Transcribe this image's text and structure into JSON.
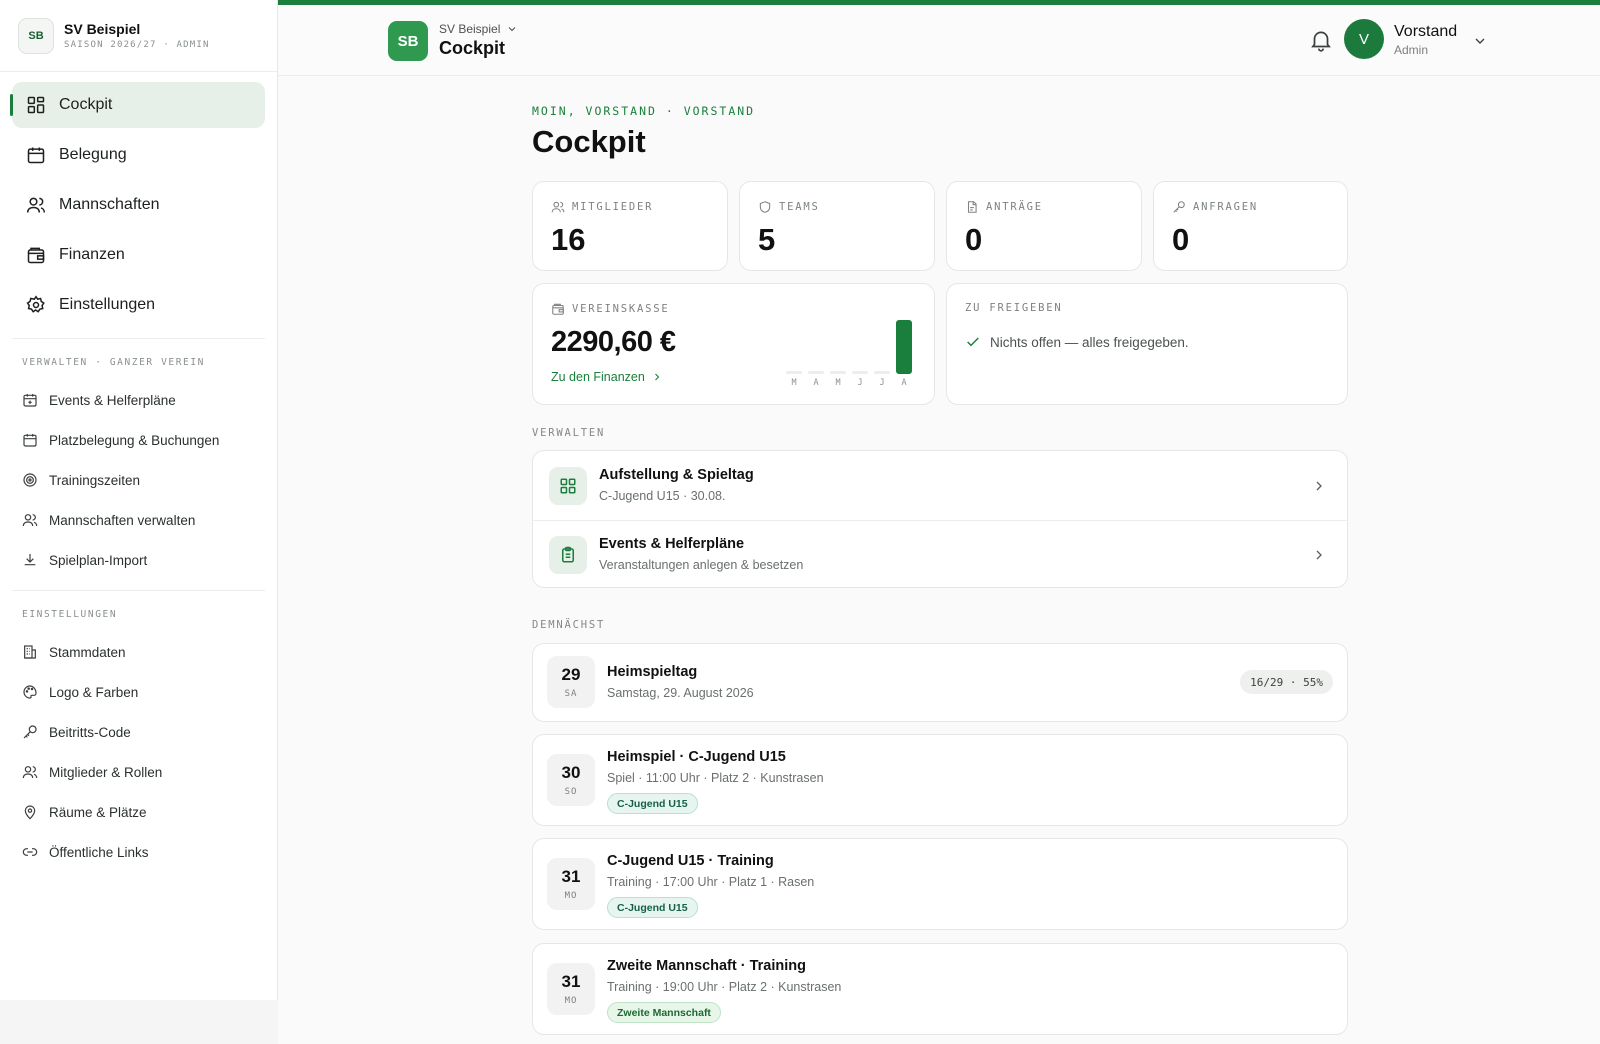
{
  "sidebar": {
    "brand": {
      "initials": "SB",
      "name": "SV Beispiel",
      "sub": "SAISON 2026/27 · ADMIN"
    },
    "main_nav": [
      {
        "label": "Cockpit",
        "icon": "grid-icon",
        "active": true
      },
      {
        "label": "Belegung",
        "icon": "calendar-icon"
      },
      {
        "label": "Mannschaften",
        "icon": "users-icon"
      },
      {
        "label": "Finanzen",
        "icon": "wallet-icon"
      },
      {
        "label": "Einstellungen",
        "icon": "gear-icon"
      }
    ],
    "section_manage": "VERWALTEN · GANZER VEREIN",
    "manage_items": [
      {
        "label": "Events & Helferpläne",
        "icon": "calendar-plus-icon"
      },
      {
        "label": "Platzbelegung & Buchungen",
        "icon": "calendar-icon"
      },
      {
        "label": "Trainingszeiten",
        "icon": "target-icon"
      },
      {
        "label": "Mannschaften verwalten",
        "icon": "users-icon"
      },
      {
        "label": "Spielplan-Import",
        "icon": "download-icon"
      }
    ],
    "section_settings": "EINSTELLUNGEN",
    "settings_items": [
      {
        "label": "Stammdaten",
        "icon": "building-icon"
      },
      {
        "label": "Logo & Farben",
        "icon": "palette-icon"
      },
      {
        "label": "Beitritts-Code",
        "icon": "key-icon"
      },
      {
        "label": "Mitglieder & Rollen",
        "icon": "users-icon"
      },
      {
        "label": "Räume & Plätze",
        "icon": "map-pin-icon"
      },
      {
        "label": "Öffentliche Links",
        "icon": "link-icon"
      }
    ]
  },
  "header": {
    "logo": "SB",
    "club": "SV Beispiel",
    "title": "Cockpit",
    "user": {
      "initial": "V",
      "name": "Vorstand",
      "role": "Admin"
    }
  },
  "page": {
    "greeting": "MOIN, VORSTAND · VORSTAND",
    "title": "Cockpit"
  },
  "stats": [
    {
      "label": "MITGLIEDER",
      "value": "16",
      "icon": "users-icon"
    },
    {
      "label": "TEAMS",
      "value": "5",
      "icon": "shield-icon"
    },
    {
      "label": "ANTRÄGE",
      "value": "0",
      "icon": "document-icon"
    },
    {
      "label": "ANFRAGEN",
      "value": "0",
      "icon": "key-icon"
    }
  ],
  "kasse": {
    "label": "VEREINSKASSE",
    "value": "2290,60 €",
    "link": "Zu den Finanzen",
    "months": [
      "M",
      "A",
      "M",
      "J",
      "J",
      "A"
    ],
    "levels": [
      0.04,
      0.04,
      0.04,
      0.04,
      0.04,
      1.0
    ],
    "accent": "#1a7f3c",
    "muted": "#eceeec"
  },
  "approve": {
    "label": "ZU FREIGEBEN",
    "text": "Nichts offen — alles freigegeben."
  },
  "manage": {
    "label": "VERWALTEN",
    "items": [
      {
        "title": "Aufstellung & Spieltag",
        "sub": "C-Jugend U15 · 30.08.",
        "icon": "grid-icon"
      },
      {
        "title": "Events & Helferpläne",
        "sub": "Veranstaltungen anlegen & besetzen",
        "icon": "clipboard-icon"
      }
    ]
  },
  "upcoming": {
    "label": "DEMNÄCHST",
    "events": [
      {
        "day": "29",
        "dow": "SA",
        "title": "Heimspieltag",
        "sub": "Samstag, 29. August 2026",
        "pill": "16/29 · 55%"
      },
      {
        "day": "30",
        "dow": "SO",
        "title": "Heimspiel · C-Jugend U15",
        "sub": "Spiel · 11:00 Uhr · Platz 2 · Kunstrasen",
        "tag": "C-Jugend U15"
      },
      {
        "day": "31",
        "dow": "MO",
        "title": "C-Jugend U15 · Training",
        "sub": "Training · 17:00 Uhr · Platz 1 · Rasen",
        "tag": "C-Jugend U15"
      },
      {
        "day": "31",
        "dow": "MO",
        "title": "Zweite Mannschaft · Training",
        "sub": "Training · 19:00 Uhr · Platz 2 · Kunstrasen",
        "tag": "Zweite Mannschaft"
      }
    ]
  }
}
